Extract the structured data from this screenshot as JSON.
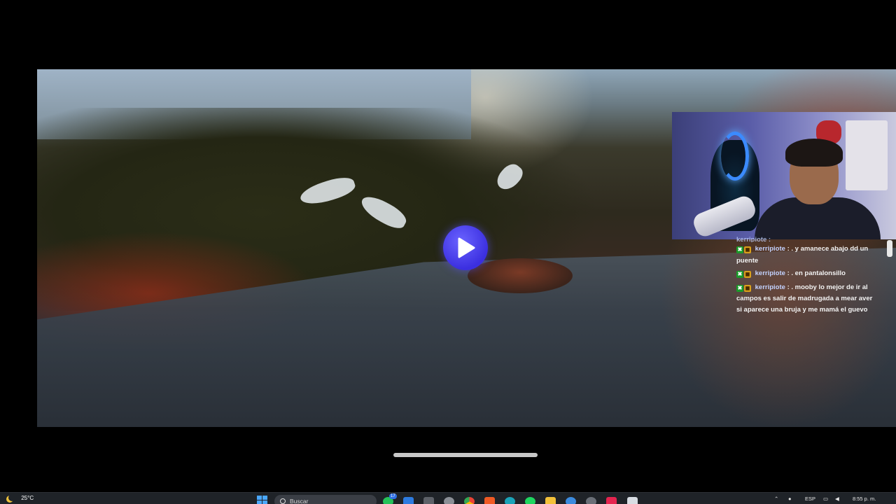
{
  "chat": {
    "partial_line": "kerripiote :",
    "messages": [
      {
        "user": "kerripiote",
        "sep": ":",
        "text": ". y amanece abajo dd un puente"
      },
      {
        "user": "kerripiote",
        "sep": ":",
        "text": ". en pantalonsillo"
      },
      {
        "user": "kerripiote",
        "sep": ":",
        "text": ". mooby lo mejor de ir al campos es salir de madrugada a mear aver si aparece una bruja y me mamá el guevo"
      }
    ]
  },
  "player": {
    "play_icon": "play-icon",
    "accent": "#3b2fe0"
  },
  "taskbar": {
    "weather_temp": "25°C",
    "search_placeholder": "Buscar",
    "language": "ESP",
    "time": "8:55 p. m.",
    "icons": [
      "whatsapp-icon",
      "mail-icon",
      "notes-icon",
      "settings-icon",
      "chrome-icon",
      "brave-icon",
      "edge-icon",
      "spotify-icon",
      "folder-icon",
      "store-icon",
      "messenger-icon",
      "tiktok-icon",
      "app-icon"
    ],
    "notification_badge": "17"
  }
}
